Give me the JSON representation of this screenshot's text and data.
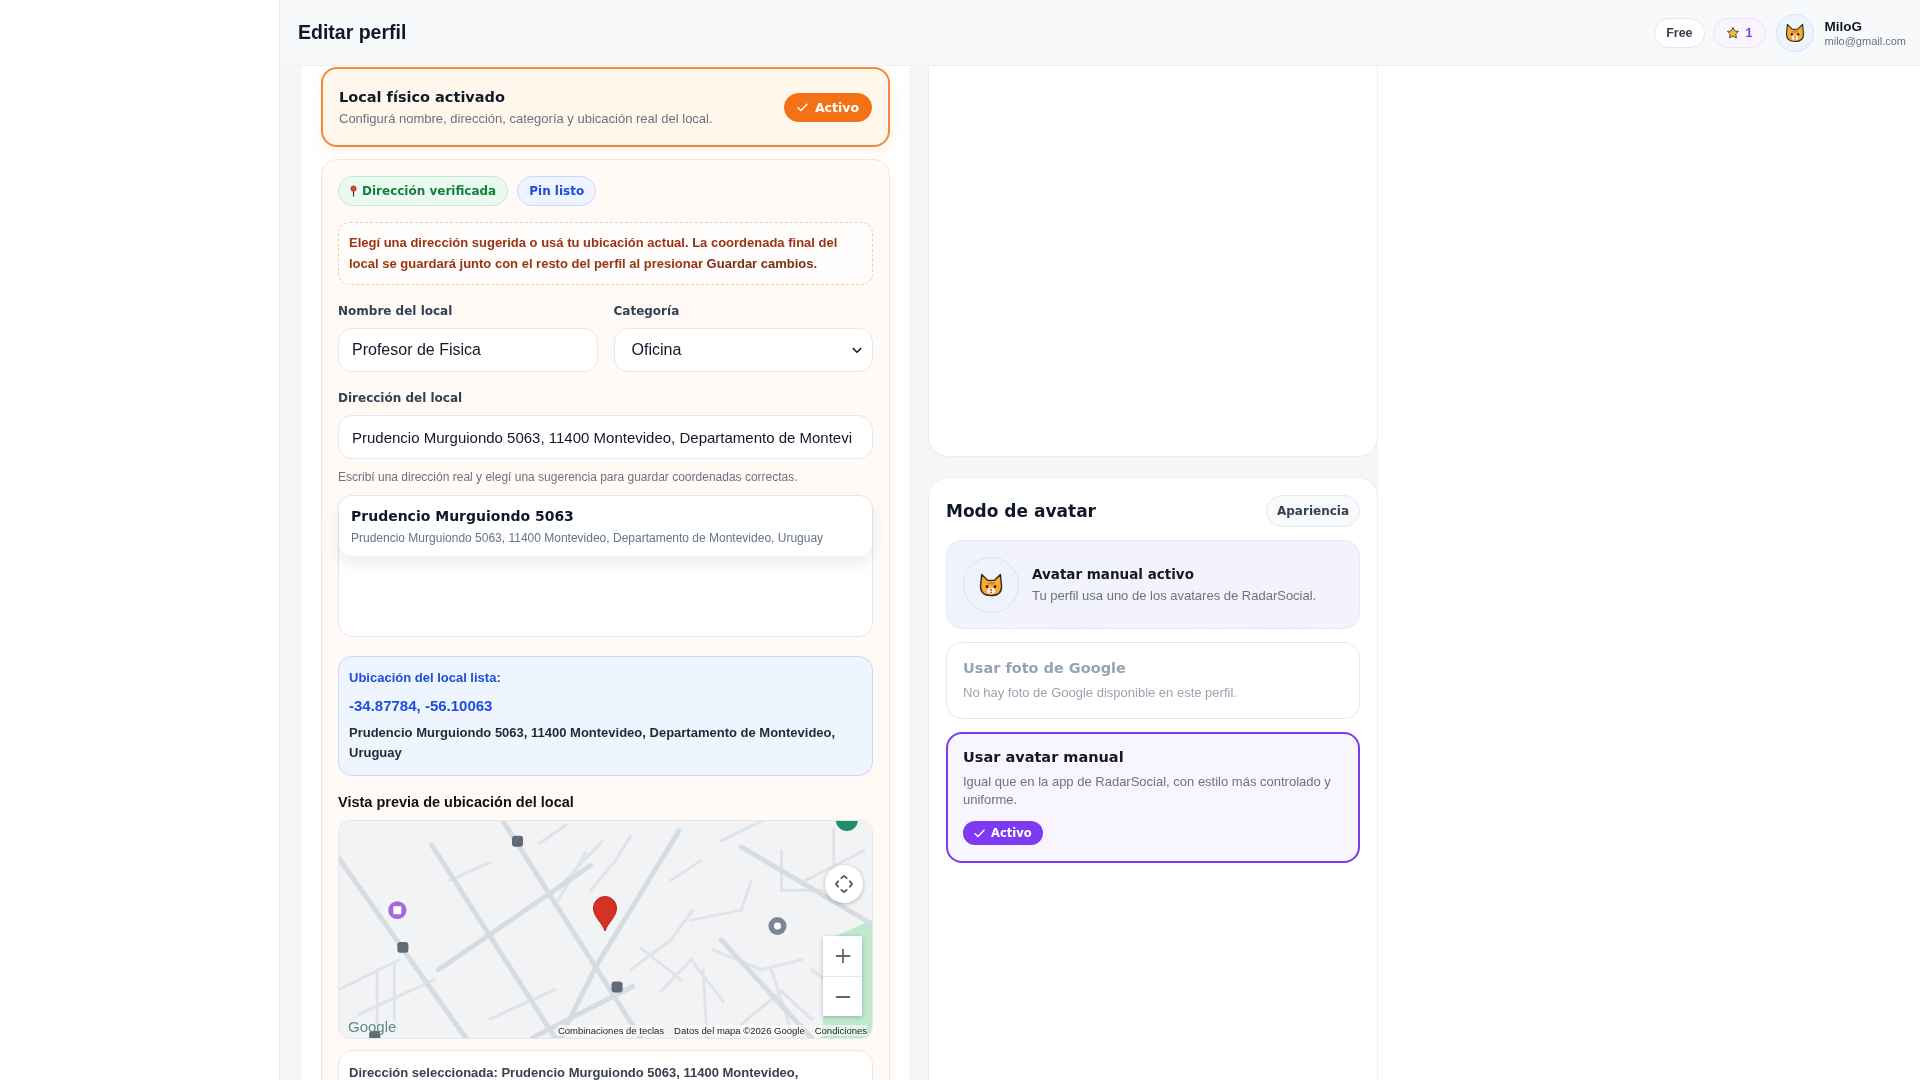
{
  "header": {
    "title": "Editar perfil",
    "plan": "Free",
    "star_count": "1",
    "user": {
      "name": "MiloG",
      "email": "milo@gmail.com"
    }
  },
  "local_card": {
    "title": "Local físico activado",
    "description": "Configurá nombre, dirección, categoría y ubicación real del local.",
    "active": true,
    "status_label": "Activo"
  },
  "location_form": {
    "badges": [
      {
        "kind": "verified",
        "label": "Dirección verificada"
      },
      {
        "kind": "pin",
        "label": "Pin listo"
      }
    ],
    "notice": "Elegí una dirección sugerida o usá tu ubicación actual. La coordenada final del local se guardará junto con el resto del perfil al presionar **Guardar cambios**.",
    "name_field": {
      "label": "Nombre del local",
      "value": "Profesor de Fisica"
    },
    "category_field": {
      "label": "Categoría",
      "value": "Oficina"
    },
    "address_field": {
      "label": "Dirección del local",
      "value": "Prudencio Murguiondo 5063, 11400 Montevideo, Departamento de Montevi",
      "hint": "Escribí una dirección real y elegí una sugerencia para guardar coordenadas correctas."
    },
    "suggestions": [
      {
        "title": "Prudencio Murguiondo 5063",
        "address": "Prudencio Murguiondo 5063, 11400 Montevideo, Departamento de Montevideo, Uruguay"
      }
    ],
    "location_ready": {
      "title": "Ubicación del local lista:",
      "coordinates": "-34.87784, -56.10063",
      "address": "Prudencio Murguiondo 5063, 11400 Montevideo, Departamento de Montevideo, Uruguay"
    },
    "map_preview": {
      "title": "Vista previa de ubicación del local",
      "logo": "Google",
      "attribution": [
        "Combinaciones de teclas",
        "Datos del mapa ©2026 Google",
        "Condiciones"
      ]
    },
    "selected_address": "Dirección seleccionada: Prudencio Murguiondo 5063, 11400 Montevideo,"
  },
  "avatar_mode": {
    "title": "Modo de avatar",
    "tag": "Apariencia",
    "current": {
      "title": "Avatar manual activo",
      "description": "Tu perfil usa uno de los avatares de RadarSocial."
    },
    "options": [
      {
        "title": "Usar foto de Google",
        "description": "No hay foto de Google disponible en este perfil.",
        "disabled": true,
        "selected": false
      },
      {
        "title": "Usar avatar manual",
        "description": "Igual que en la app de RadarSocial, con estilo más controlado y uniforme.",
        "disabled": false,
        "selected": true,
        "badge": "Activo"
      }
    ]
  }
}
